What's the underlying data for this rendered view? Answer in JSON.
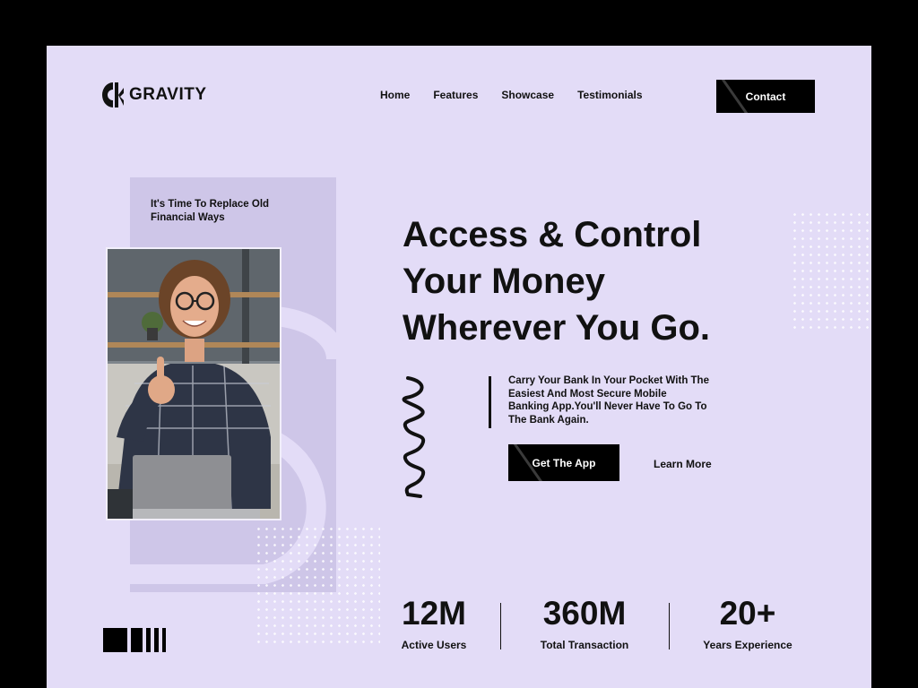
{
  "brand": {
    "name": "GRAVITY"
  },
  "nav": {
    "items": [
      "Home",
      "Features",
      "Showcase",
      "Testimonials"
    ],
    "contact_label": "Contact"
  },
  "hero": {
    "tagline": "It's Time To Replace Old Financial Ways",
    "headline_lines": [
      "Access & Control",
      "Your Money",
      "Wherever You Go."
    ],
    "description": "Carry Your Bank In Your Pocket With The Easiest And Most Secure Mobile Banking App.You'll Never Have To Go To The Bank Again.",
    "primary_cta": "Get The App",
    "secondary_cta": "Learn More"
  },
  "stats": [
    {
      "value": "12M",
      "label": "Active Users"
    },
    {
      "value": "360M",
      "label": "Total Transaction"
    },
    {
      "value": "20+",
      "label": "Years Experience"
    }
  ],
  "colors": {
    "background": "#e3dcf7",
    "panel": "#cec6e8",
    "accent": "#000000"
  }
}
